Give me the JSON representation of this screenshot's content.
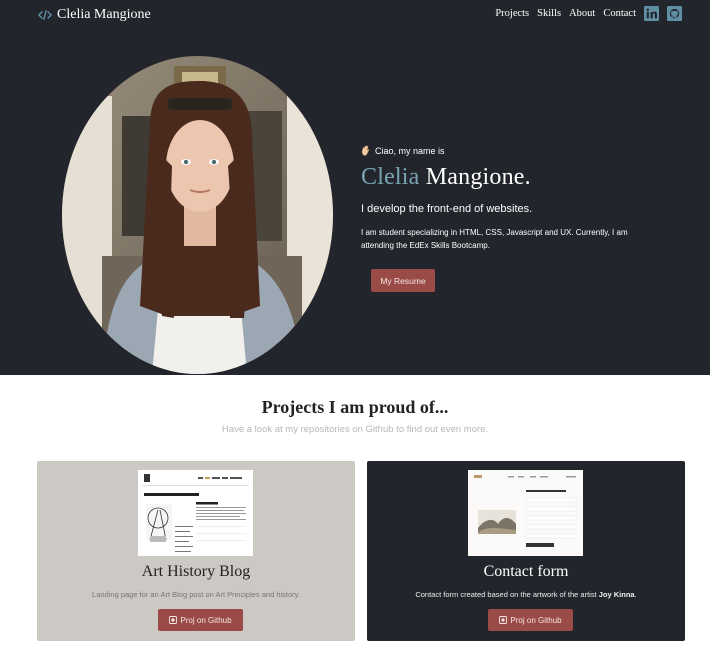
{
  "nav": {
    "brand": "Clelia Mangione",
    "links": [
      "Projects",
      "Skills",
      "About",
      "Contact"
    ],
    "icons": [
      "linkedin-icon",
      "github-icon"
    ]
  },
  "hero": {
    "greeting": "Ciao, my name is",
    "first_name": "Clelia",
    "last_name": "Mangione.",
    "tagline": "I develop the front-end of websites.",
    "description": "I am student specializing in HTML, CSS, Javascript and UX. Currently, I am attending the EdEx Skills Bootcamp.",
    "resume_button": "My Resume"
  },
  "projects": {
    "title": "Projects I am proud of...",
    "subtitle": "Have a look at my repositories on Github to find out even more.",
    "items": [
      {
        "title": "Art History Blog",
        "description": "Landing page for an Art Blog post on Art Principles and history.",
        "button": "Proj on Github"
      },
      {
        "title": "Contact form",
        "description_prefix": "Contact form created based on the artwork of the artist ",
        "description_bold": "Joy Kinna",
        "description_suffix": ".",
        "button": "Proj on Github"
      }
    ]
  },
  "colors": {
    "dark_bg": "#22252b",
    "accent_blue": "#7aa4b4",
    "button_red": "#9a4b48",
    "card_grey": "#ccc8c4"
  }
}
